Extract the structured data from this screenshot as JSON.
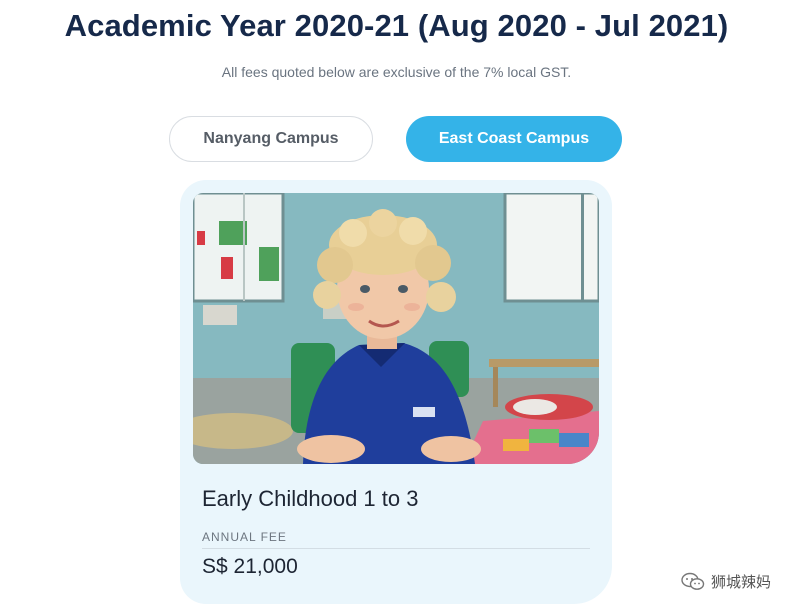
{
  "header": {
    "title": "Academic Year 2020-21 (Aug 2020 - Jul 2021)",
    "subtitle": "All fees quoted below are exclusive of the 7% local GST."
  },
  "campus_tabs": [
    {
      "label": "Nanyang Campus",
      "selected": false
    },
    {
      "label": "East Coast Campus",
      "selected": true
    }
  ],
  "fee_card": {
    "program": "Early Childhood 1 to 3",
    "fee_label": "ANNUAL FEE",
    "fee_value": "S$ 21,000"
  },
  "watermark": {
    "text": "狮城辣妈",
    "icon": "wechat-icon"
  },
  "colors": {
    "title": "#16294a",
    "accent": "#34b3e8",
    "card_background": "#eaf6fc"
  }
}
